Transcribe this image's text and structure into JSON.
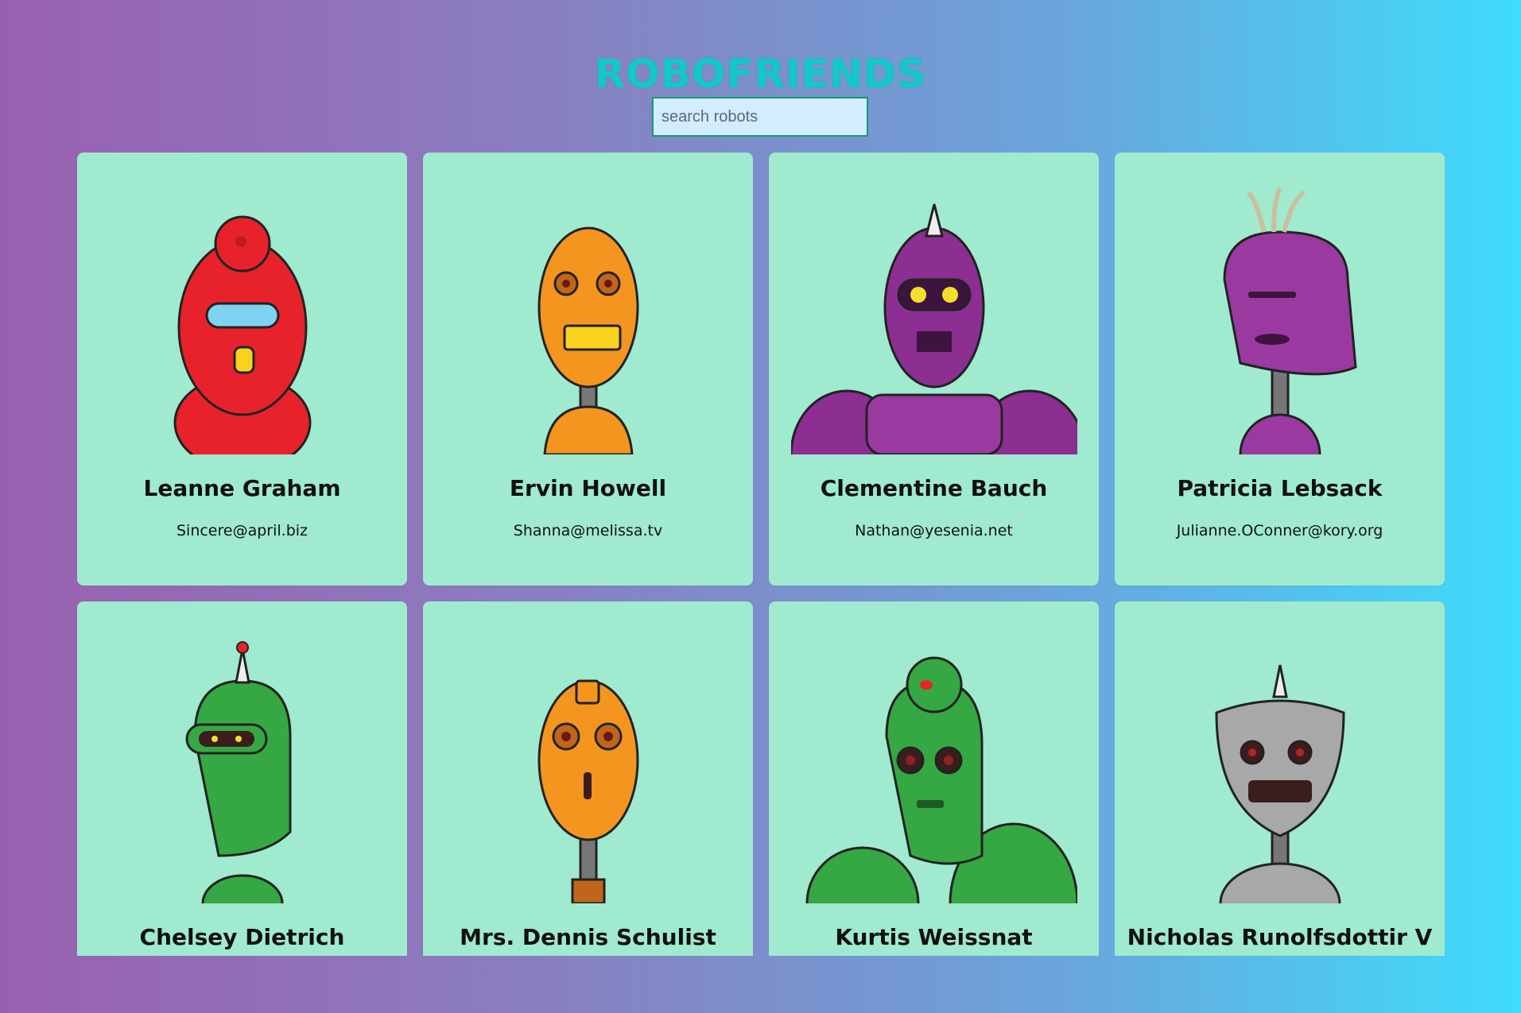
{
  "app": {
    "title": "ROBOFRIENDS"
  },
  "search": {
    "placeholder": "search robots",
    "value": ""
  },
  "robots": [
    {
      "name": "Leanne Graham",
      "email": "Sincere@april.biz",
      "color": "#e8222b"
    },
    {
      "name": "Ervin Howell",
      "email": "Shanna@melissa.tv",
      "color": "#f3951f"
    },
    {
      "name": "Clementine Bauch",
      "email": "Nathan@yesenia.net",
      "color": "#8c2e92"
    },
    {
      "name": "Patricia Lebsack",
      "email": "Julianne.OConner@kory.org",
      "color": "#9a3aa0"
    },
    {
      "name": "Chelsey Dietrich",
      "email": "",
      "color": "#35a843"
    },
    {
      "name": "Mrs. Dennis Schulist",
      "email": "",
      "color": "#f3951f"
    },
    {
      "name": "Kurtis Weissnat",
      "email": "",
      "color": "#35a843"
    },
    {
      "name": "Nicholas Runolfsdottir V",
      "email": "",
      "color": "#a8a8a8"
    }
  ]
}
